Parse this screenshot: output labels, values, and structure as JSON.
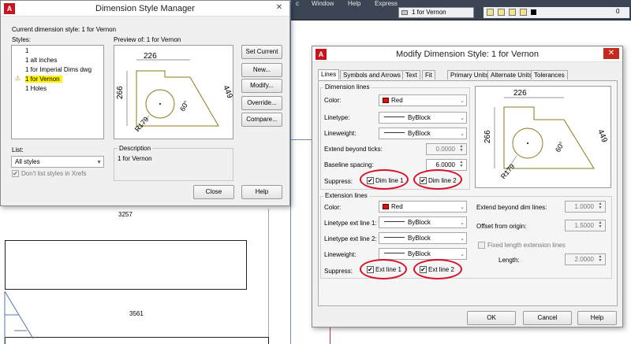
{
  "cad": {
    "menus": [
      "c",
      "Window",
      "Help",
      "Express"
    ],
    "layer_name": "1 for Vernon",
    "toolbar_value": "0",
    "dims": [
      "3257",
      "3561"
    ]
  },
  "manager": {
    "title": "Dimension Style Manager",
    "current_style": "Current dimension style: 1 for Vernon",
    "styles_label": "Styles:",
    "styles": [
      "1",
      "1 alt inches",
      "1 for Imperial Dims dwg",
      "1 for Vernon",
      "1 Holes"
    ],
    "selected_style_index": 3,
    "preview_label": "Preview of: 1 for Vernon",
    "buttons": [
      "Set Current",
      "New...",
      "Modify...",
      "Override...",
      "Compare..."
    ],
    "list_label": "List:",
    "list_value": "All styles",
    "dont_list": "Don't list styles in Xrefs",
    "desc_label": "Description",
    "desc_value": "1 for Vernon",
    "close": "Close",
    "help": "Help",
    "preview_dims": {
      "top": "226",
      "left": "266",
      "right": "449",
      "angle": "60°",
      "radius": "R179"
    }
  },
  "modify": {
    "title": "Modify Dimension Style: 1 for Vernon",
    "tabs": [
      "Lines",
      "Symbols and Arrows",
      "Text",
      "Fit",
      "Primary Units",
      "Alternate Units",
      "Tolerances"
    ],
    "active_tab": "Lines",
    "dim_lines": {
      "group": "Dimension lines",
      "color_label": "Color:",
      "color_value": "Red",
      "linetype_label": "Linetype:",
      "linetype_value": "ByBlock",
      "lineweight_label": "Lineweight:",
      "lineweight_value": "ByBlock",
      "extend_label": "Extend beyond ticks:",
      "extend_value": "0.0000",
      "baseline_label": "Baseline spacing:",
      "baseline_value": "6.0000",
      "suppress_label": "Suppress:",
      "dim1": "Dim line 1",
      "dim2": "Dim line 2"
    },
    "ext_lines": {
      "group": "Extension lines",
      "color_label": "Color:",
      "color_value": "Red",
      "lt1_label": "Linetype ext line 1:",
      "lt1_value": "ByBlock",
      "lt2_label": "Linetype ext line 2:",
      "lt2_value": "ByBlock",
      "lw_label": "Lineweight:",
      "lw_value": "ByBlock",
      "suppress_label": "Suppress:",
      "ext1": "Ext line 1",
      "ext2": "Ext line 2",
      "beyond_label": "Extend beyond dim lines:",
      "beyond_value": "1.0000",
      "offset_label": "Offset from origin:",
      "offset_value": "1.5000",
      "fixed_label": "Fixed length extension lines",
      "length_label": "Length:",
      "length_value": "2.0000"
    },
    "preview_dims": {
      "top": "226",
      "left": "266",
      "right": "449",
      "angle": "60°",
      "radius": "R179"
    },
    "ok": "OK",
    "cancel": "Cancel",
    "help": "Help"
  },
  "colors": {
    "red_swatch": "#d11111",
    "highlight": "#fff200",
    "annotation": "#d5122a",
    "preview_line": "#8b7a1a"
  }
}
